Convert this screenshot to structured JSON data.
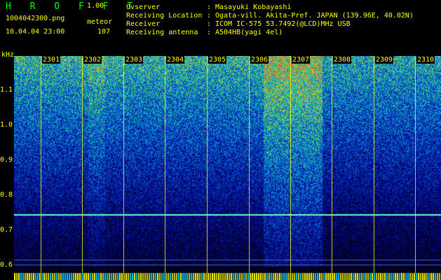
{
  "header": {
    "app_title": "H R O F F T",
    "version": "1.00",
    "file_name": "1004042300.png",
    "datetime": "10.04.04 23:00",
    "meteor_label": "meteor",
    "meteor_count": "107"
  },
  "info": [
    {
      "label": "Ovserver",
      "value": "Masayuki Kobayashi"
    },
    {
      "label": "Receiving Location",
      "value": "Ogata-vill. Akita-Pref. JAPAN (139.96E, 40.02N)"
    },
    {
      "label": "Receiver",
      "value": "ICOM IC-575 53.7492(@LCD)MHz USB"
    },
    {
      "label": "Receiving antenna",
      "value": "A504HB(yagi 4el)"
    }
  ],
  "axis": {
    "unit": "kHz",
    "ylabels": [
      "1.1",
      "1.0",
      "0.9",
      "0.8",
      "0.7",
      "0.6"
    ],
    "time_labels": [
      "2301",
      "2302",
      "2303",
      "2304",
      "2305",
      "2306",
      "2307",
      "2308",
      "2309",
      "2310"
    ]
  },
  "colors": {
    "text": "#ffff00",
    "title": "#00ff00",
    "background": "#000000",
    "carrier_line": "#66ffcc"
  }
}
